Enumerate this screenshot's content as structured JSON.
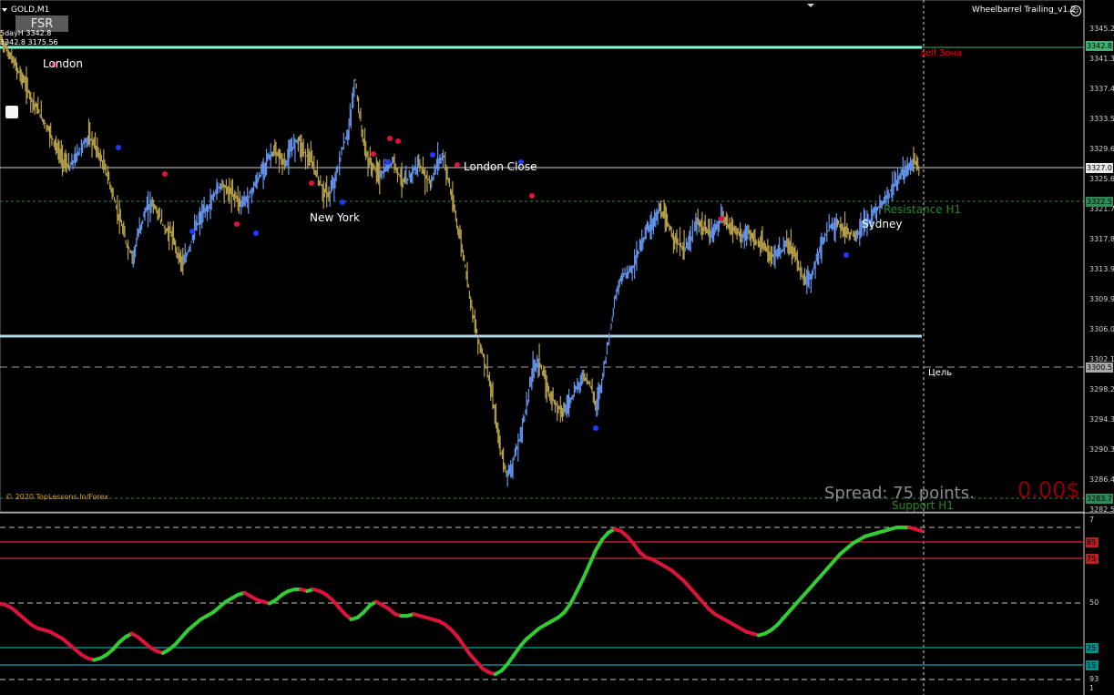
{
  "window": {
    "symbol_title": "GOLD,M1",
    "ea_name": "Wheelbarrel Trailing_v1.2",
    "fsr_button": "FSR",
    "info_line_1": "5dayH 3342.8",
    "info_line_2": "3342.8 3175.56",
    "copyright": "© 2020 TopLessons.In/Forex"
  },
  "sessions": {
    "london": "London",
    "new_york": "New York",
    "london_close": "London Close",
    "sydney": "Sydney"
  },
  "zones": {
    "sell_zone": "sell Зона",
    "resistance": "Resistance H1",
    "support": "Support H1",
    "target": "Цель"
  },
  "status": {
    "spread": "Spread: 75 points.",
    "pnl": "0.00$"
  },
  "price_axis": {
    "ticks": [
      "3345.2",
      "3341.3",
      "3337.4",
      "3333.5",
      "3329.6",
      "3325.6",
      "3321.7",
      "3317.8",
      "3313.9",
      "3309.9",
      "3306.0",
      "3302.1",
      "3298.2",
      "3294.3",
      "3290.3",
      "3286.4",
      "3282.5"
    ],
    "tags": {
      "sell_level": "3342.8",
      "current": "3327.0",
      "resistance": "3322.5",
      "target": "3300.5",
      "support": "3283.7"
    }
  },
  "indicator_axis": {
    "ticks": [
      "7",
      "50",
      "93",
      "1"
    ],
    "tags": {
      "upper_1": "85",
      "upper_2": "75",
      "lower_1": "25",
      "lower_2": "15"
    }
  },
  "colors": {
    "background": "#000000",
    "sell_line": "#7fffd4",
    "support_line": "#add8e6",
    "candle_up": "#6495ed",
    "candle_down": "#b8a14a",
    "osc_up": "#32cd32",
    "osc_down": "#dc143c",
    "red_level": "#b22222",
    "teal_level": "#008b8b",
    "resistance_text": "#228b22",
    "sell_text": "#ff0000"
  },
  "chart_data": {
    "type": "line",
    "title": "",
    "xlabel": "",
    "ylabel": "",
    "ylim": [
      3282.5,
      3345.2
    ],
    "series": [
      {
        "values": [
          3344.0,
          3342.5,
          3341.0,
          3339.5,
          3338.0,
          3336.0,
          3334.5,
          3333.0,
          3331.5,
          3329.5,
          3328.0,
          3327.0,
          3328.5,
          3330.0,
          3331.0,
          3330.0,
          3328.0,
          3326.0,
          3323.0,
          3320.0,
          3317.0,
          3315.5,
          3319.0,
          3321.5,
          3322.5,
          3321.0,
          3319.0,
          3318.5,
          3316.0,
          3314.5,
          3317.0,
          3319.5,
          3321.0,
          3322.0,
          3324.0,
          3325.0,
          3324.0,
          3323.5,
          3322.5,
          3323.0,
          3324.5,
          3326.0,
          3328.0,
          3329.0,
          3328.5,
          3327.5,
          3329.5,
          3331.0,
          3329.0,
          3328.0,
          3326.0,
          3324.0,
          3323.5,
          3326.0,
          3329.5,
          3332.0,
          3338.5,
          3332.0,
          3328.0,
          3327.0,
          3326.0,
          3327.0,
          3328.0,
          3326.0,
          3325.0,
          3326.5,
          3327.5,
          3326.0,
          3325.0,
          3328.0,
          3328.5,
          3324.0,
          3320.0,
          3316.0,
          3311.0,
          3306.0,
          3303.0,
          3300.0,
          3295.0,
          3290.0,
          3287.0,
          3289.0,
          3292.0,
          3296.0,
          3301.0,
          3302.0,
          3299.0,
          3297.0,
          3296.0,
          3295.5,
          3297.0,
          3298.5,
          3300.0,
          3299.0,
          3296.0,
          3300.0,
          3305.0,
          3310.0,
          3313.0,
          3313.5,
          3314.5,
          3317.0,
          3319.0,
          3320.0,
          3321.5,
          3320.0,
          3318.5,
          3317.0,
          3316.5,
          3318.0,
          3320.0,
          3319.0,
          3318.5,
          3319.5,
          3320.5,
          3319.5,
          3319.0,
          3318.0,
          3318.5,
          3317.5,
          3317.0,
          3316.0,
          3315.5,
          3316.0,
          3317.0,
          3316.5,
          3314.0,
          3312.0,
          3313.0,
          3316.0,
          3318.0,
          3319.5,
          3320.0,
          3319.0,
          3318.5,
          3318.0,
          3319.5,
          3320.0,
          3321.5,
          3322.5,
          3323.5,
          3325.0,
          3326.0,
          3327.0,
          3328.0,
          3327.0
        ]
      }
    ],
    "oscillator": {
      "ylim": [
        0,
        100
      ],
      "levels": [
        85,
        75,
        25,
        15
      ],
      "values": [
        50,
        49,
        47,
        44,
        41,
        38,
        36,
        35,
        34,
        32,
        30,
        27,
        24,
        21,
        19,
        18,
        19,
        21,
        24,
        28,
        31,
        33,
        31,
        28,
        25,
        23,
        22,
        24,
        27,
        31,
        35,
        38,
        41,
        43,
        45,
        48,
        51,
        53,
        55,
        56,
        54,
        52,
        51,
        50,
        52,
        55,
        57,
        58,
        58,
        57,
        58,
        57,
        55,
        52,
        48,
        44,
        41,
        42,
        45,
        49,
        51,
        49,
        47,
        44,
        43,
        43,
        44,
        43,
        42,
        41,
        40,
        38,
        35,
        31,
        26,
        21,
        17,
        13,
        11,
        10,
        12,
        16,
        21,
        26,
        30,
        33,
        36,
        38,
        40,
        42,
        45,
        50,
        57,
        64,
        72,
        80,
        86,
        90,
        92,
        91,
        88,
        84,
        79,
        76,
        75,
        73,
        71,
        69,
        66,
        63,
        59,
        55,
        51,
        47,
        44,
        42,
        40,
        38,
        36,
        34,
        33,
        32,
        33,
        35,
        38,
        42,
        46,
        50,
        54,
        58,
        62,
        66,
        70,
        74,
        78,
        81,
        84,
        86,
        88,
        89,
        90,
        91,
        92,
        93,
        93,
        93,
        92,
        91
      ]
    }
  }
}
